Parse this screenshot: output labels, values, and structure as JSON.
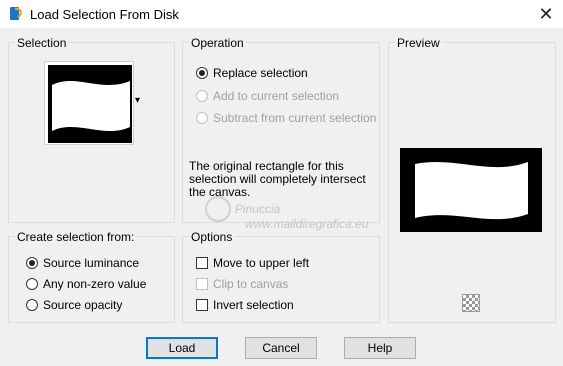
{
  "window": {
    "title": "Load Selection From Disk",
    "close_glyph": "✕"
  },
  "selection_group": {
    "label": "Selection",
    "dropdown_glyph": "▾"
  },
  "operation_group": {
    "label": "Operation",
    "options": [
      {
        "label": "Replace selection",
        "selected": true,
        "enabled": true
      },
      {
        "label": "Add to current selection",
        "selected": false,
        "enabled": false
      },
      {
        "label": "Subtract from current selection",
        "selected": false,
        "enabled": false
      }
    ],
    "note": "The original rectangle for this selection will completely intersect the canvas."
  },
  "preview_group": {
    "label": "Preview"
  },
  "create_group": {
    "label": "Create selection from:",
    "options": [
      {
        "label": "Source luminance",
        "selected": true
      },
      {
        "label": "Any non-zero value",
        "selected": false
      },
      {
        "label": "Source opacity",
        "selected": false
      }
    ]
  },
  "options_group": {
    "label": "Options",
    "checkboxes": [
      {
        "label": "Move to upper left",
        "checked": false,
        "enabled": true
      },
      {
        "label": "Clip to canvas",
        "checked": false,
        "enabled": false
      },
      {
        "label": "Invert selection",
        "checked": false,
        "enabled": true
      }
    ]
  },
  "buttons": {
    "load": "Load",
    "cancel": "Cancel",
    "help": "Help"
  },
  "watermark": {
    "line1": "Pinuccia",
    "line2": "www.maildiregrafica.eu"
  }
}
